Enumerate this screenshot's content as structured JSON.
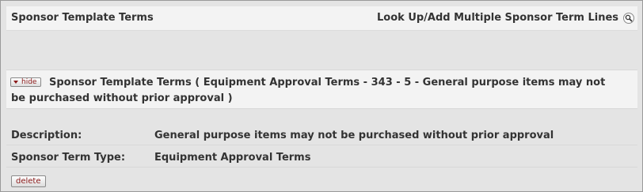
{
  "section": {
    "title": "Sponsor Template Terms",
    "lookup_label": "Look Up/Add Multiple Sponsor Term Lines",
    "lookup_icon": "magnifier-icon"
  },
  "term": {
    "toggle_label": "hide",
    "toggle_icon": "triangle-down-icon",
    "heading": "Sponsor Template Terms ( Equipment Approval Terms - 343 - 5 - General purpose items may not be purchased without prior approval )",
    "fields": [
      {
        "label": "Description:",
        "value": "General purpose items may not be purchased without prior approval"
      },
      {
        "label": "Sponsor Term Type:",
        "value": "Equipment Approval Terms"
      }
    ],
    "delete_label": "delete"
  }
}
